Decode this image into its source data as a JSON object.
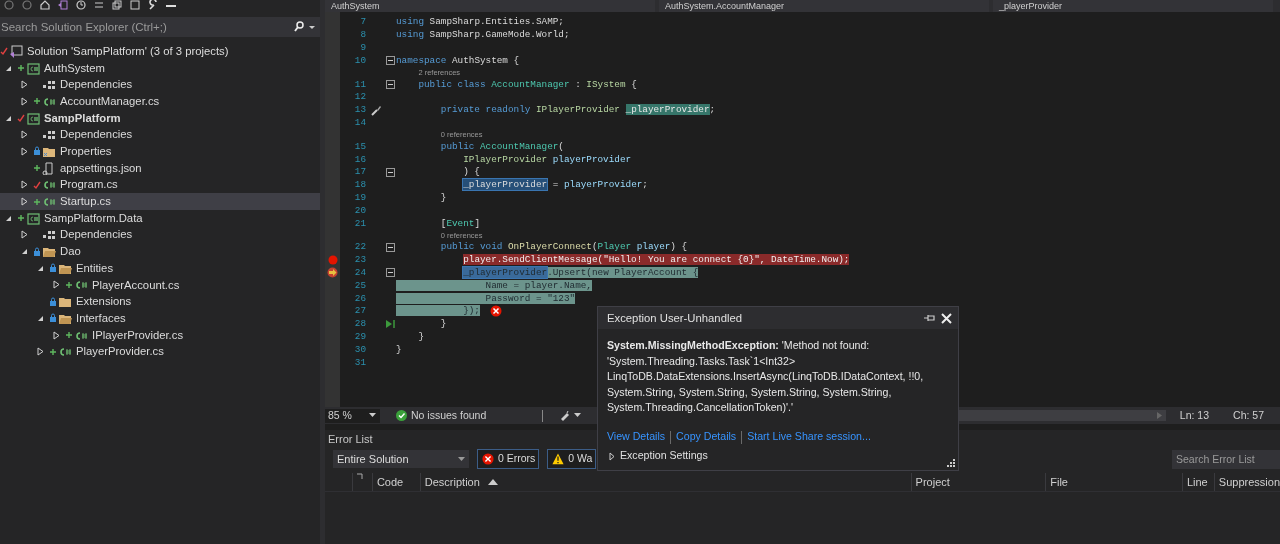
{
  "solution_explorer": {
    "search": {
      "placeholder": "Search Solution Explorer (Ctrl+;)"
    },
    "tree": [
      {
        "label": "Solution 'SampPlatform' (3 of 3 projects)",
        "kind": "solution",
        "vcs": {
          "kind": "modified"
        },
        "selected": false,
        "startup": false,
        "children": [
          {
            "label": "AuthSystem",
            "kind": "project",
            "vcs": {
              "kind": "added"
            },
            "expanded": true,
            "selected": false,
            "startup": false,
            "children": [
              {
                "label": "Dependencies",
                "kind": "dependencies",
                "expanded": false,
                "selected": false,
                "startup": false
              },
              {
                "label": "AccountManager.cs",
                "kind": "csharp",
                "vcs": {
                  "kind": "added"
                },
                "expanded": false,
                "selected": false,
                "startup": false
              }
            ]
          },
          {
            "label": "SampPlatform",
            "kind": "project",
            "vcs": {
              "kind": "modified"
            },
            "expanded": true,
            "selected": false,
            "startup": true,
            "children": [
              {
                "label": "Dependencies",
                "kind": "dependencies",
                "expanded": false,
                "selected": false,
                "startup": false
              },
              {
                "label": "Properties",
                "kind": "properties",
                "vcs": {
                  "kind": "checked-in"
                },
                "expanded": false,
                "selected": false,
                "startup": false
              },
              {
                "label": "appsettings.json",
                "kind": "json",
                "vcs": {
                  "kind": "added"
                },
                "selected": false,
                "startup": false
              },
              {
                "label": "Program.cs",
                "kind": "csharp",
                "vcs": {
                  "kind": "modified"
                },
                "expanded": false,
                "selected": false,
                "startup": false
              },
              {
                "label": "Startup.cs",
                "kind": "csharp",
                "vcs": {
                  "kind": "added"
                },
                "expanded": false,
                "selected": true,
                "startup": false
              }
            ]
          },
          {
            "label": "SampPlatform.Data",
            "kind": "project",
            "vcs": {
              "kind": "added"
            },
            "expanded": true,
            "selected": false,
            "startup": false,
            "children": [
              {
                "label": "Dependencies",
                "kind": "dependencies",
                "expanded": false,
                "selected": false,
                "startup": false
              },
              {
                "label": "Dao",
                "kind": "folder",
                "vcs": {
                  "kind": "checked-in"
                },
                "expanded": true,
                "selected": false,
                "startup": false,
                "children": [
                  {
                    "label": "Entities",
                    "kind": "folder",
                    "vcs": {
                      "kind": "checked-in"
                    },
                    "expanded": true,
                    "selected": false,
                    "startup": false,
                    "children": [
                      {
                        "label": "PlayerAccount.cs",
                        "kind": "csharp",
                        "vcs": {
                          "kind": "added"
                        },
                        "expanded": false,
                        "selected": false,
                        "startup": false
                      }
                    ]
                  },
                  {
                    "label": "Extensions",
                    "kind": "folder-closed",
                    "vcs": {
                      "kind": "checked-in"
                    },
                    "selected": false,
                    "startup": false
                  },
                  {
                    "label": "Interfaces",
                    "kind": "folder",
                    "vcs": {
                      "kind": "checked-in"
                    },
                    "expanded": true,
                    "selected": false,
                    "startup": false,
                    "children": [
                      {
                        "label": "IPlayerProvider.cs",
                        "kind": "csharp",
                        "vcs": {
                          "kind": "added"
                        },
                        "expanded": false,
                        "selected": false,
                        "startup": false
                      }
                    ]
                  },
                  {
                    "label": "PlayerProvider.cs",
                    "kind": "csharp",
                    "vcs": {
                      "kind": "added"
                    },
                    "expanded": false,
                    "selected": false,
                    "startup": false
                  }
                ]
              }
            ]
          }
        ]
      }
    ]
  },
  "editor": {
    "navigation": [
      "AuthSystem",
      "AuthSystem.AccountManager",
      "_playerProvider"
    ],
    "lines": [
      {
        "kind": "code",
        "number": "7",
        "tokens": [
          {
            "kind": "kw",
            "t": "using"
          },
          {
            "kind": "plain",
            "t": " SampSharp.Entities.SAMP;"
          }
        ]
      },
      {
        "kind": "code",
        "number": "8",
        "tokens": [
          {
            "kind": "kw",
            "t": "using"
          },
          {
            "kind": "plain",
            "t": " SampSharp.GameMode.World;"
          }
        ]
      },
      {
        "kind": "code",
        "number": "9"
      },
      {
        "kind": "code",
        "number": "10",
        "fold": true,
        "tokens": [
          {
            "kind": "kw",
            "t": "namespace"
          },
          {
            "kind": "plain",
            "t": " AuthSystem {"
          }
        ]
      },
      {
        "kind": "codelens",
        "text": "2 references"
      },
      {
        "kind": "code",
        "number": "11",
        "fold": true,
        "tokens": [
          {
            "kind": "kw",
            "t": "    public class"
          },
          {
            "kind": "type",
            "t": " AccountManager"
          },
          {
            "kind": "plain",
            "t": " : "
          },
          {
            "kind": "iface",
            "t": "ISystem"
          },
          {
            "kind": "plain",
            "t": " {"
          }
        ]
      },
      {
        "kind": "code",
        "number": "12"
      },
      {
        "kind": "code",
        "number": "13",
        "marker": {
          "kind": "quick-action"
        },
        "tokens": [
          {
            "kind": "kw",
            "t": "        private readonly"
          },
          {
            "kind": "iface",
            "t": " IPlayerProvider "
          },
          {
            "kind": "plain",
            "t": "_playerProvider",
            "highlight": {
              "kind": "reference"
            }
          },
          {
            "kind": "plain",
            "t": ";"
          }
        ]
      },
      {
        "kind": "code",
        "number": "14"
      },
      {
        "kind": "codelens",
        "text": "0 references"
      },
      {
        "kind": "code",
        "number": "15",
        "tokens": [
          {
            "kind": "kw",
            "t": "        public"
          },
          {
            "kind": "type",
            "t": " AccountManager"
          },
          {
            "kind": "plain",
            "t": "("
          }
        ]
      },
      {
        "kind": "code",
        "number": "16",
        "tokens": [
          {
            "kind": "iface",
            "t": "            IPlayerProvider"
          },
          {
            "kind": "param",
            "t": " playerProvider"
          }
        ]
      },
      {
        "kind": "code",
        "number": "17",
        "fold": true,
        "tokens": [
          {
            "kind": "plain",
            "t": "            ) {"
          }
        ]
      },
      {
        "kind": "code",
        "number": "18",
        "tokens": [
          {
            "kind": "plain",
            "t": "            _playerProvider",
            "highlight": {
              "kind": "write"
            }
          },
          {
            "kind": "plain",
            "t": " = "
          },
          {
            "kind": "param",
            "t": "playerProvider"
          },
          {
            "kind": "plain",
            "t": ";"
          }
        ]
      },
      {
        "kind": "code",
        "number": "19",
        "tokens": [
          {
            "kind": "plain",
            "t": "        }"
          }
        ]
      },
      {
        "kind": "code",
        "number": "20"
      },
      {
        "kind": "code",
        "number": "21",
        "tokens": [
          {
            "kind": "plain",
            "t": "        ["
          },
          {
            "kind": "type",
            "t": "Event"
          },
          {
            "kind": "plain",
            "t": "]"
          }
        ]
      },
      {
        "kind": "codelens",
        "text": "0 references"
      },
      {
        "kind": "code",
        "number": "22",
        "fold": true,
        "tokens": [
          {
            "kind": "kw",
            "t": "        public void"
          },
          {
            "kind": "method",
            "t": " OnPlayerConnect"
          },
          {
            "kind": "plain",
            "t": "("
          },
          {
            "kind": "type",
            "t": "Player"
          },
          {
            "kind": "param",
            "t": " player"
          },
          {
            "kind": "plain",
            "t": ") {"
          }
        ]
      },
      {
        "kind": "code",
        "number": "23",
        "marker": {
          "kind": "breakpoint"
        },
        "tokens": [
          {
            "kind": "plain",
            "t": "            player.SendClientMessage(\"Hello! You are connect {0}\", DateTime.Now);",
            "highlight": {
              "kind": "breakpoint"
            }
          }
        ]
      },
      {
        "kind": "code",
        "number": "24",
        "marker": {
          "kind": "breakpoint-current"
        },
        "fold": true,
        "tokens": [
          {
            "kind": "plain",
            "t": "            _playerProvider",
            "highlight": {
              "kind": "current-write"
            }
          },
          {
            "kind": "plain",
            "t": ".Upsert(new PlayerAccount {",
            "highlight": {
              "kind": "current"
            }
          }
        ]
      },
      {
        "kind": "code",
        "number": "25",
        "tokens": [
          {
            "kind": "plain",
            "t": "                Name = player.Name,",
            "highlight": {
              "kind": "current-full"
            }
          }
        ]
      },
      {
        "kind": "code",
        "number": "26",
        "tokens": [
          {
            "kind": "plain",
            "t": "                Password = \"123\"",
            "highlight": {
              "kind": "current-full"
            }
          }
        ]
      },
      {
        "kind": "code",
        "number": "27",
        "error": true,
        "tokens": [
          {
            "kind": "plain",
            "t": "            });",
            "highlight": {
              "kind": "current-full"
            }
          }
        ]
      },
      {
        "kind": "code",
        "number": "28",
        "marker": {
          "kind": "run-to-click"
        },
        "tokens": [
          {
            "kind": "plain",
            "t": "        }"
          }
        ]
      },
      {
        "kind": "code",
        "number": "29",
        "tokens": [
          {
            "kind": "plain",
            "t": "    }"
          }
        ]
      },
      {
        "kind": "code",
        "number": "30",
        "tokens": [
          {
            "kind": "plain",
            "t": "}"
          }
        ]
      },
      {
        "kind": "code",
        "number": "31"
      }
    ],
    "status": {
      "zoom": "85 %",
      "issues": "No issues found",
      "line": "Ln: 13",
      "column": "Ch: 57"
    }
  },
  "exception_popup": {
    "title": "Exception User-Unhandled",
    "message": "**System.MissingMethodException:** 'Method not found: 'System.Threading.Tasks.Task`1<Int32> LinqToDB.DataExtensions.InsertAsync(LinqToDB.IDataContext, !!0, System.String, System.String, System.String, System.String, System.Threading.CancellationToken)'.'",
    "links": [
      "View Details",
      "Copy Details",
      "Start Live Share session..."
    ],
    "settings": {
      "label": "Exception Settings",
      "expanded": false
    }
  },
  "error_list": {
    "title": "Error List",
    "scope": "Entire Solution",
    "filters": [
      {
        "kind": "error",
        "label": "0 Errors"
      },
      {
        "kind": "warning",
        "label": "0 Wa"
      }
    ],
    "search": {
      "placeholder": "Search Error List"
    },
    "columns": [
      {
        "label": "Code",
        "sorted": false
      },
      {
        "label": "Description",
        "sorted": true
      },
      {
        "label": "Project",
        "sorted": false
      },
      {
        "label": "File",
        "sorted": false
      },
      {
        "label": "Line",
        "sorted": false
      },
      {
        "label": "Suppression",
        "sorted": false
      }
    ]
  }
}
